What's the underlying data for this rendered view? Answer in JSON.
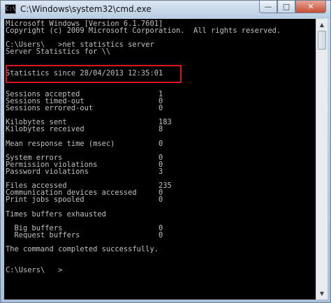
{
  "window": {
    "title": "C:\\Windows\\system32\\cmd.exe",
    "icon_glyph": "C:\\",
    "minimize_glyph": "—",
    "maximize_glyph": "□",
    "close_glyph": "✕"
  },
  "console": {
    "lines": [
      "Microsoft Windows [Version 6.1.7601]",
      "Copyright (c) 2009 Microsoft Corporation.  All rights reserved.",
      "",
      "C:\\Users\\   >net statistics server",
      "Server Statistics for \\\\",
      "",
      "",
      "Statistics since 28/04/2013 12:35:01",
      "",
      "",
      "Sessions accepted                  1",
      "Sessions timed-out                 0",
      "Sessions errored-out               0",
      "",
      "Kilobytes sent                     183",
      "Kilobytes received                 8",
      "",
      "Mean response time (msec)          0",
      "",
      "System errors                      0",
      "Permission violations              0",
      "Password violations                3",
      "",
      "Files accessed                     235",
      "Communication devices accessed     0",
      "Print jobs spooled                 0",
      "",
      "Times buffers exhausted",
      "",
      "  Big buffers                      0",
      "  Request buffers                  0",
      "",
      "The command completed successfully.",
      "",
      "",
      "C:\\Users\\   >"
    ]
  },
  "scrollbar": {
    "up_glyph": "▲",
    "down_glyph": "▼"
  },
  "colors": {
    "console_bg": "#000000",
    "console_text": "#c0c0c0",
    "highlight_border": "#d8151b"
  }
}
